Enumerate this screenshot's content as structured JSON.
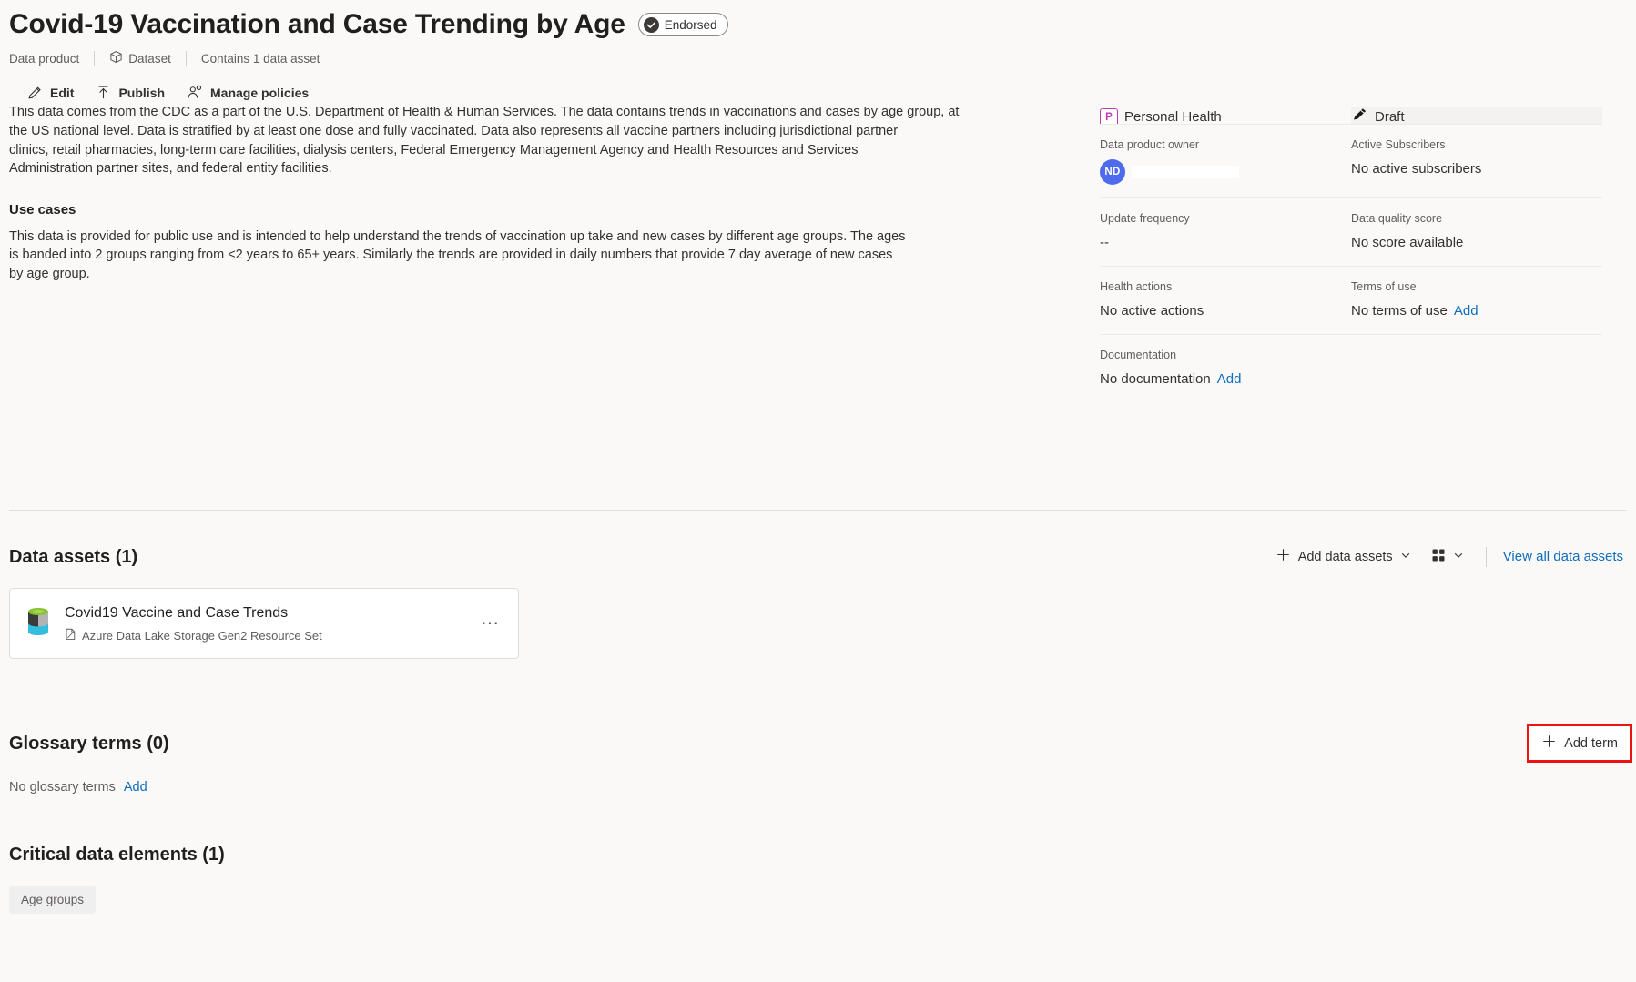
{
  "header": {
    "title": "Covid-19 Vaccination and Case Trending by Age",
    "endorsed_label": "Endorsed",
    "kind_label": "Data product",
    "dataset_label": "Dataset",
    "asset_count_label": "Contains 1 data asset"
  },
  "commandbar": {
    "edit_label": "Edit",
    "publish_label": "Publish",
    "manage_policies_label": "Manage policies"
  },
  "description": {
    "line_clipped": "This data comes from the CDC as a part of the U.S. Department of Health & Human Services.  The data contains trends in vaccinations and cases by age group, at",
    "body": "the US national level. Data is stratified by at least one dose and fully vaccinated. Data also represents all vaccine partners including jurisdictional partner clinics, retail pharmacies, long-term care facilities, dialysis centers, Federal Emergency Management Agency and Health Resources and Services Administration partner sites, and federal entity facilities.",
    "use_cases_heading": "Use cases",
    "use_cases_body": "This data is provided for public use and is intended to help understand the trends of vaccination up take and new cases by different age groups.  The ages is banded into 2 groups ranging from <2 years to 65+ years.  Similarly the trends are provided in daily numbers that provide 7 day average of new cases by age group."
  },
  "details": {
    "classification_value": "Personal Health",
    "classification_badge": "P",
    "status_value": "Draft",
    "owner_label": "Data product owner",
    "owner_initials": "ND",
    "subscribers_label": "Active Subscribers",
    "subscribers_value": "No active subscribers",
    "update_frequency_label": "Update frequency",
    "update_frequency_value": "--",
    "quality_label": "Data quality score",
    "quality_value": "No score available",
    "health_label": "Health actions",
    "health_value": "No active actions",
    "terms_label": "Terms of use",
    "terms_value": "No terms of use",
    "terms_add": "Add",
    "documentation_label": "Documentation",
    "documentation_value": "No documentation",
    "documentation_add": "Add"
  },
  "data_assets": {
    "title": "Data assets (1)",
    "add_label": "Add data assets",
    "view_all_label": "View all data assets",
    "items": [
      {
        "name": "Covid19 Vaccine and Case Trends",
        "type": "Azure Data Lake Storage Gen2 Resource Set"
      }
    ]
  },
  "glossary": {
    "title": "Glossary terms (0)",
    "empty_text": "No glossary terms",
    "add_link": "Add",
    "add_term_label": "Add term"
  },
  "critical_data_elements": {
    "title": "Critical data elements (1)",
    "chips": [
      "Age groups"
    ]
  },
  "colors": {
    "accent_link": "#0f6cbd",
    "classification": "#c239b3",
    "avatar": "#4f6bed",
    "annotation": "#ee1111",
    "page_bg": "#faf9f8"
  }
}
